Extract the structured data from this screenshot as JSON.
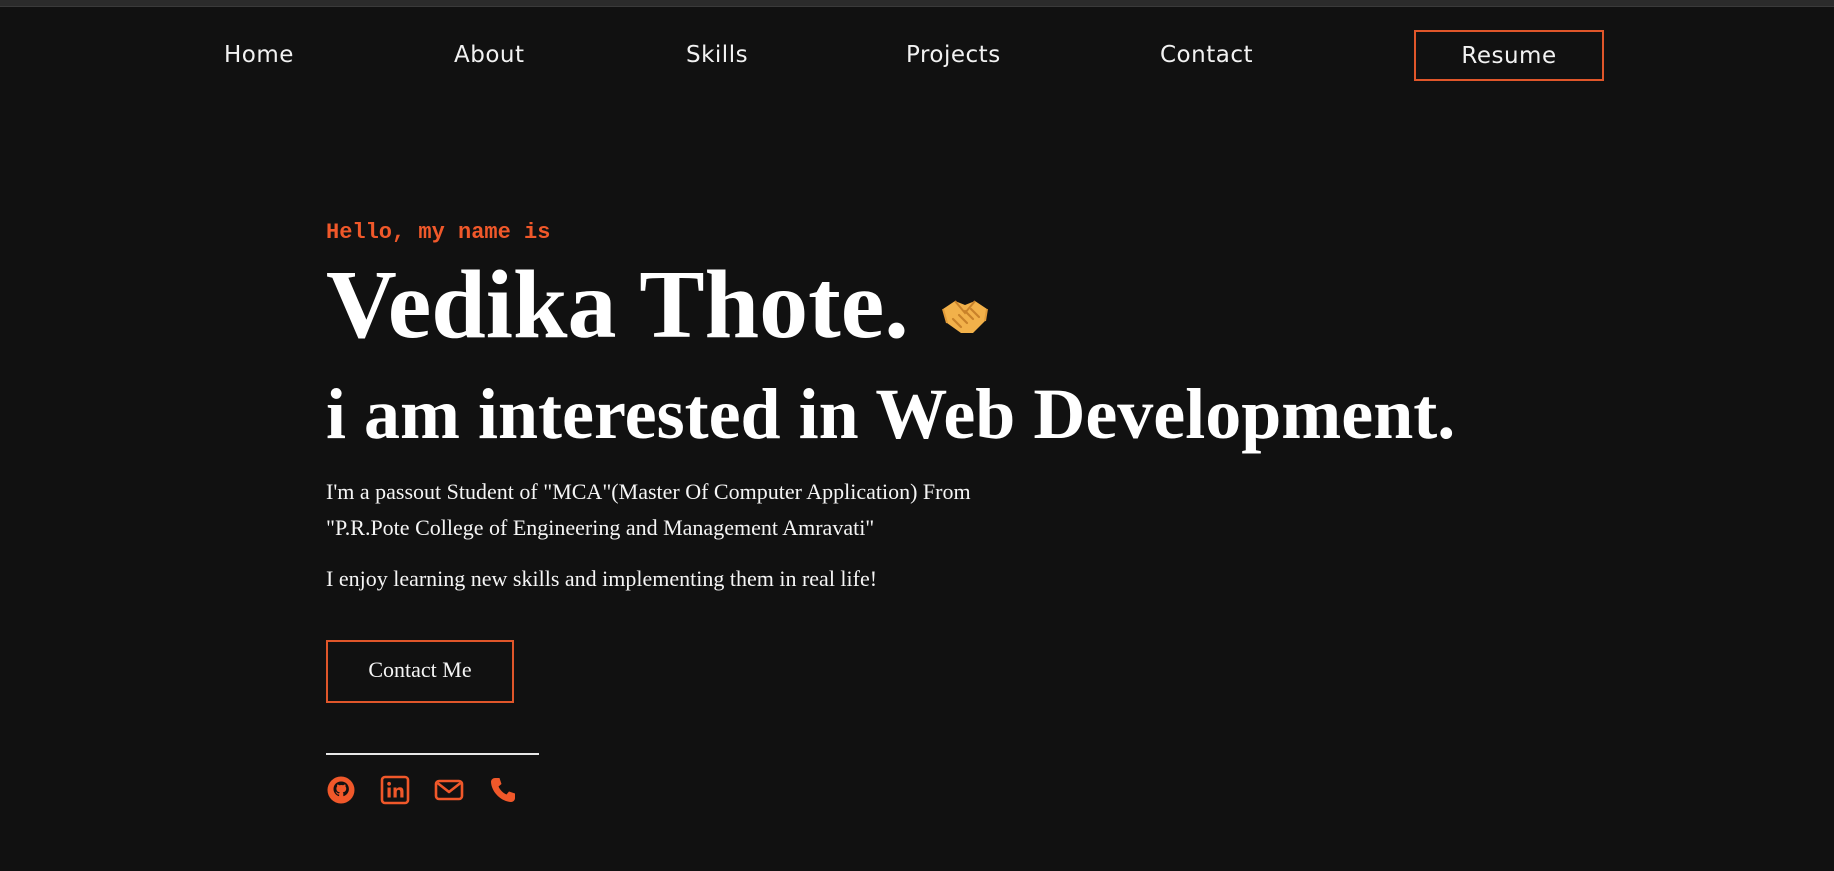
{
  "nav": {
    "items": [
      {
        "label": "Home"
      },
      {
        "label": "About"
      },
      {
        "label": "Skills"
      },
      {
        "label": "Projects"
      },
      {
        "label": "Contact"
      }
    ],
    "resume_label": "Resume"
  },
  "hero": {
    "greeting": "Hello, my name is",
    "name": "Vedika Thote.",
    "name_icon": "handshake-icon",
    "tagline": "i am interested in Web Development.",
    "bio_line1": "I'm a passout Student of \"MCA\"(Master Of Computer Application) From",
    "bio_line2": "\"P.R.Pote College of Engineering and Management Amravati\"",
    "enjoy": "I enjoy learning new skills and implementing them in real life!",
    "contact_label": "Contact Me"
  },
  "socials": [
    {
      "icon": "github-icon"
    },
    {
      "icon": "linkedin-icon"
    },
    {
      "icon": "mail-icon"
    },
    {
      "icon": "phone-icon"
    }
  ],
  "colors": {
    "background": "#111111",
    "accent": "#f0582a",
    "text": "#ffffff"
  }
}
